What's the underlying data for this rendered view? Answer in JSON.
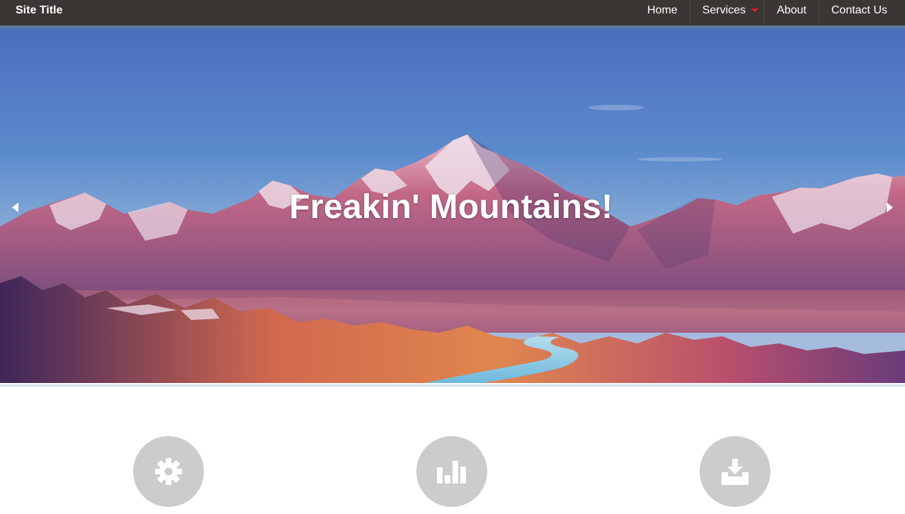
{
  "header": {
    "site_title": "Site Title",
    "nav": [
      {
        "label": "Home"
      },
      {
        "label": "Services",
        "has_dropdown": true
      },
      {
        "label": "About"
      },
      {
        "label": "Contact Us"
      }
    ]
  },
  "hero": {
    "caption": "Freakin' Mountains!",
    "prev_icon": "triangle-left-icon",
    "next_icon": "triangle-right-icon"
  },
  "features": [
    {
      "icon": "gear-icon"
    },
    {
      "icon": "bar-chart-icon"
    },
    {
      "icon": "download-tray-icon"
    }
  ],
  "colors": {
    "topbar": "#3a3634",
    "topbar_rule": "#5d7a99",
    "dropdown_caret": "#e02020",
    "feature_circle": "#cccccc"
  }
}
